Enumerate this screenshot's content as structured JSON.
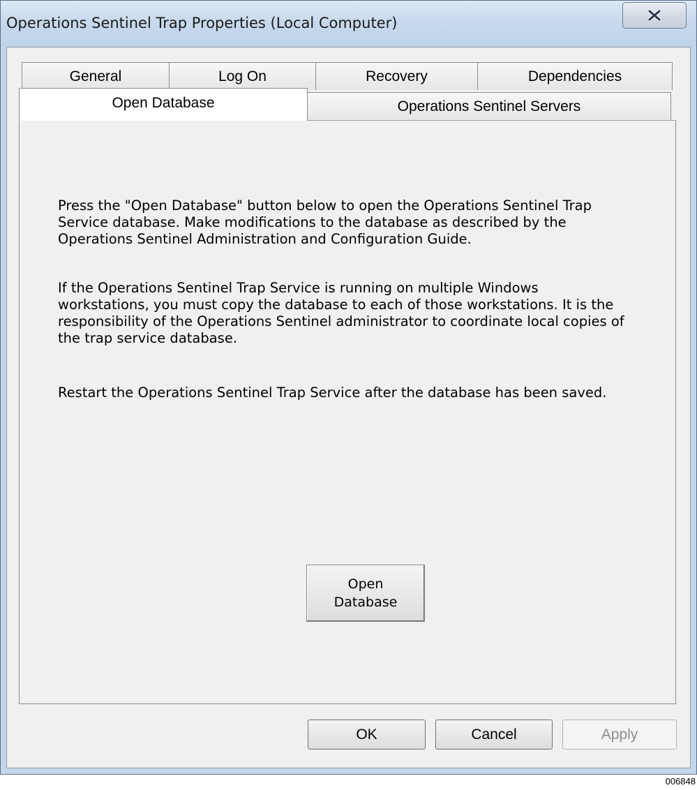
{
  "window": {
    "title": "Operations Sentinel Trap Properties (Local Computer)",
    "close_icon": "close-x-icon"
  },
  "tabs": {
    "row_back": [
      "General",
      "Log On",
      "Recovery",
      "Dependencies"
    ],
    "row_front": [
      "Open Database",
      "Operations Sentinel Servers"
    ],
    "active": "Open Database"
  },
  "content": {
    "paragraphs": [
      "Press the \"Open Database\" button below to open the Operations Sentinel Trap Service database.  Make modifications to the database as described by the Operations Sentinel Administration and Configuration Guide.",
      "If the Operations Sentinel Trap Service is running on multiple Windows workstations, you must copy the database to each of those workstations.  It is the responsibility of the Operations Sentinel administrator to coordinate local copies of the trap service database.",
      "Restart the Operations Sentinel Trap Service after the database has been saved."
    ],
    "open_button": "Open\nDatabase"
  },
  "footer": {
    "ok": "OK",
    "cancel": "Cancel",
    "apply": "Apply"
  },
  "figure_id": "006848"
}
